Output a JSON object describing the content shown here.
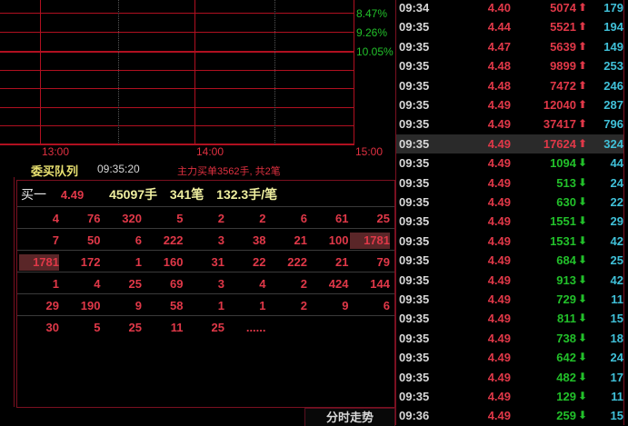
{
  "chart": {
    "pct_labels": [
      "8.47%",
      "9.26%",
      "10.05%"
    ],
    "time_labels": [
      "13:00",
      "14:00",
      "15:00"
    ]
  },
  "queue": {
    "title": "委买队列",
    "time": "09:35:20",
    "main_info": "主力买单3562手, 共2笔",
    "level": "买一",
    "price": "4.49",
    "volume": "45097手",
    "count": "341笔",
    "avg": "132.3手/笔",
    "rows": [
      [
        "4",
        "76",
        "320",
        "5",
        "2",
        "2",
        "6",
        "61",
        "25"
      ],
      [
        "7",
        "50",
        "6",
        "222",
        "3",
        "38",
        "21",
        "100",
        "1781"
      ],
      [
        "1781",
        "172",
        "1",
        "160",
        "31",
        "22",
        "222",
        "21",
        "79"
      ],
      [
        "1",
        "4",
        "25",
        "69",
        "3",
        "4",
        "2",
        "424",
        "144"
      ],
      [
        "29",
        "190",
        "9",
        "58",
        "1",
        "1",
        "2",
        "9",
        "6"
      ],
      [
        "30",
        "5",
        "25",
        "11",
        "25",
        "......"
      ]
    ],
    "selected_cells": [
      [
        1,
        8
      ],
      [
        2,
        0
      ]
    ]
  },
  "tab": {
    "label": "分时走势"
  },
  "ticks": [
    [
      "09:34",
      "4.40",
      "5074",
      "up",
      "179"
    ],
    [
      "09:35",
      "4.44",
      "5521",
      "up",
      "194"
    ],
    [
      "09:35",
      "4.47",
      "5639",
      "up",
      "149"
    ],
    [
      "09:35",
      "4.48",
      "9899",
      "up",
      "253"
    ],
    [
      "09:35",
      "4.48",
      "7472",
      "up",
      "246"
    ],
    [
      "09:35",
      "4.49",
      "12040",
      "up",
      "287"
    ],
    [
      "09:35",
      "4.49",
      "37417",
      "up",
      "796"
    ],
    [
      "09:35",
      "4.49",
      "17624",
      "up",
      "324"
    ],
    [
      "09:35",
      "4.49",
      "1094",
      "down",
      "44"
    ],
    [
      "09:35",
      "4.49",
      "513",
      "down",
      "24"
    ],
    [
      "09:35",
      "4.49",
      "630",
      "down",
      "22"
    ],
    [
      "09:35",
      "4.49",
      "1551",
      "down",
      "29"
    ],
    [
      "09:35",
      "4.49",
      "1531",
      "down",
      "42"
    ],
    [
      "09:35",
      "4.49",
      "684",
      "down",
      "25"
    ],
    [
      "09:35",
      "4.49",
      "913",
      "down",
      "42"
    ],
    [
      "09:35",
      "4.49",
      "729",
      "down",
      "11"
    ],
    [
      "09:35",
      "4.49",
      "811",
      "down",
      "15"
    ],
    [
      "09:35",
      "4.49",
      "738",
      "down",
      "18"
    ],
    [
      "09:35",
      "4.49",
      "642",
      "down",
      "24"
    ],
    [
      "09:35",
      "4.49",
      "482",
      "down",
      "17"
    ],
    [
      "09:35",
      "4.49",
      "129",
      "down",
      "11"
    ],
    [
      "09:36",
      "4.49",
      "259",
      "down",
      "15"
    ]
  ],
  "selected_tick": 7,
  "colors": {
    "up": "#e03848",
    "down": "#22c02a",
    "grid": "#b01020"
  }
}
